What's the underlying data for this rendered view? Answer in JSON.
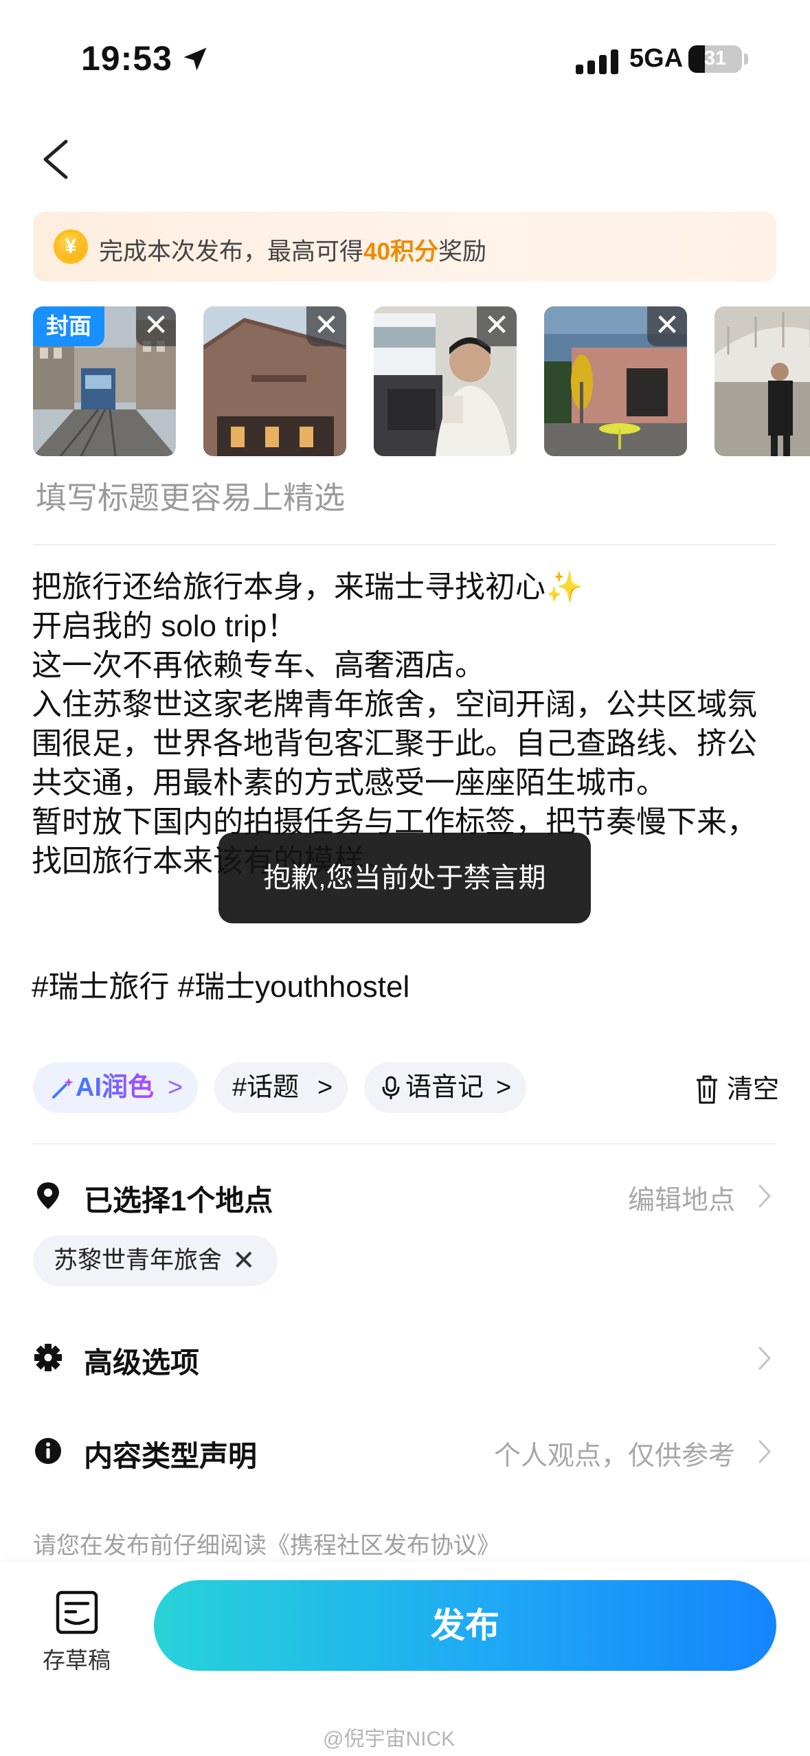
{
  "status_bar": {
    "time": "19:53",
    "network": "5GA",
    "battery": "31",
    "battery_level": 0.31
  },
  "banner": {
    "prefix": "完成本次发布，最高可得",
    "points": "40",
    "unit": "积分",
    "suffix": "奖励",
    "coin": "¥"
  },
  "thumbnails": {
    "cover_label": "封面",
    "close_glyph": "✕",
    "images": [
      "city-tram-street",
      "brick-building-facade",
      "man-on-train",
      "cafe-terrace",
      "station-hall"
    ]
  },
  "title_placeholder": "填写标题更容易上精选",
  "post": {
    "lines": [
      "把旅行还给旅行本身，来瑞士寻找初心✨",
      "开启我的 solo trip！",
      "这一次不再依赖专车、高奢酒店。",
      "入住苏黎世这家老牌青年旅舍，空间开阔，公共区域氛围很足，世界各地背包客汇聚于此。自己查路线、挤公共交通，用最朴素的方式感受一座座陌生城市。",
      "暂时放下国内的拍摄任务与工作标签，把节奏慢下来，找回旅行本来该有的模样。"
    ],
    "hashtags": "#瑞士旅行 #瑞士youthhostel"
  },
  "toast": "抱歉,您当前处于禁言期",
  "tools": {
    "ai_label": "AI润色",
    "topic_label": "#话题",
    "voice_label": "语音记",
    "chevron": ">",
    "clear_label": "清空"
  },
  "location": {
    "label": "已选择1个地点",
    "action": "编辑地点",
    "place": "苏黎世青年旅舍",
    "remove": "✕"
  },
  "advanced": {
    "label": "高级选项"
  },
  "content_type": {
    "label": "内容类型声明",
    "value": "个人观点，仅供参考"
  },
  "agreement": "请您在发布前仔细阅读《携程社区发布协议》",
  "bottom": {
    "draft_label": "存草稿",
    "publish_label": "发布",
    "watermark": "@倪宇宙NICK"
  },
  "colors": {
    "accent": "#1890ff",
    "points": "#f08a00",
    "publish_start": "#27d3d8",
    "publish_end": "#1585ff"
  }
}
